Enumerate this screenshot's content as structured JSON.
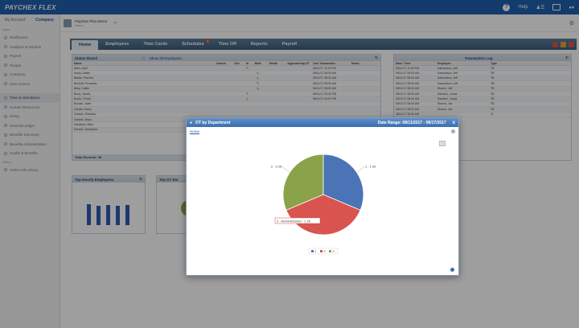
{
  "topbar": {
    "brand": "PAYCHEX FLEX",
    "help": "Help"
  },
  "leftnav": {
    "tabs": [
      "My Account",
      "Company"
    ],
    "section1": "Apps",
    "items1": [
      "Dashboard",
      "Analytics & Reports",
      "Payroll",
      "People",
      "Company",
      "User Access"
    ],
    "items2": [
      "Time & Attendance",
      "Human Resources",
      "Hiring",
      "General Ledger",
      "Benefits Summary",
      "Benefits Administration",
      "Health & Benefits"
    ],
    "section2": "Offers",
    "items3": [
      "Online HR Library"
    ]
  },
  "company": {
    "name": "Paychex Flex Demo",
    "sub": "Demo"
  },
  "tabs": [
    {
      "label": "Home",
      "badge": ""
    },
    {
      "label": "Employees",
      "badge": ""
    },
    {
      "label": "Time Cards",
      "badge": ""
    },
    {
      "label": "Schedules",
      "badge": "1"
    },
    {
      "label": "Time Off",
      "badge": ""
    },
    {
      "label": "Reports",
      "badge": ""
    },
    {
      "label": "Payroll",
      "badge": ""
    }
  ],
  "status_board": {
    "title": "Status Board",
    "show_all": "Show all employees",
    "headers": [
      "Name",
      "Absent",
      "Out",
      "In",
      "Meal",
      "Break",
      "Approaching OT",
      "Last Transaction",
      "Notes"
    ],
    "rows": [
      {
        "name": "Allen, April",
        "status": "out",
        "last": "08/11/17 11:00 PM"
      },
      {
        "name": "Avery, Austin",
        "status": "in",
        "last": "08/11/17 08:00 AM"
      },
      {
        "name": "Barker, Pamela",
        "status": "in",
        "last": "08/11/17 08:00 AM"
      },
      {
        "name": "Beckett, Fernando",
        "status": "in",
        "last": "08/11/17 08:00 AM"
      },
      {
        "name": "Berg, Caitlin",
        "status": "in",
        "last": "08/11/17 08:00 AM"
      },
      {
        "name": "Bond, James",
        "status": "out",
        "last": "08/11/17 04:00 PM"
      },
      {
        "name": "Booth, Frieda",
        "status": "out",
        "last": "08/11/17 04:00 PM"
      },
      {
        "name": "Brooke, Jalen",
        "status": "",
        "last": ""
      },
      {
        "name": "Carden, Barry",
        "status": "",
        "last": ""
      },
      {
        "name": "Chaves, Eduardo",
        "status": "",
        "last": ""
      },
      {
        "name": "Daniels, Brian",
        "status": "",
        "last": ""
      },
      {
        "name": "Davidson, Mike",
        "status": "",
        "last": ""
      },
      {
        "name": "Dorsett, Samantha",
        "status": "",
        "last": ""
      }
    ],
    "footer": "Total Records: 38"
  },
  "transaction_log": {
    "title": "Transaction Log",
    "headers": [
      "Date / Time",
      "Employee",
      "Type"
    ],
    "rows": [
      {
        "date": "08/11/17 11:00 PM",
        "emp": "Samuelson, Jeff",
        "type": "TB"
      },
      {
        "date": "08/11/17 08:00 AM",
        "emp": "Samuelson, Jeff",
        "type": "TB"
      },
      {
        "date": "08/11/17 08:00 AM",
        "emp": "Samuelson, Jeff",
        "type": "TB"
      },
      {
        "date": "08/11/17 08:00 AM",
        "emp": "Samuelson, Jeff",
        "type": "TB"
      },
      {
        "date": "08/11/17 08:00 AM",
        "emp": "Shaver, Jeff",
        "type": "TB"
      },
      {
        "date": "08/11/17 08:00 AM",
        "emp": "Ramirez, Jonas",
        "type": "TB"
      },
      {
        "date": "08/11/17 08:00 AM",
        "emp": "Ramirez, Jonas",
        "type": "TB"
      },
      {
        "date": "08/11/17 08:00 AM",
        "emp": "Shaver, Joe",
        "type": "TB"
      },
      {
        "date": "08/11/17 08:00 AM",
        "emp": "Shaver, Joe",
        "type": "TB"
      },
      {
        "date": "08/11/17 08:00 AM",
        "emp": "",
        "type": "CI"
      }
    ]
  },
  "hourly_panel": {
    "title": "Top Hourly Employees"
  },
  "ot_panel": {
    "title": "Top OT Em"
  },
  "modal": {
    "title": "OT by Department",
    "range": "Date Range: 08/11/2017 - 08/17/2017",
    "home_link": "Home",
    "close": "x"
  },
  "chart_data": {
    "type": "pie",
    "slices": [
      {
        "name": "1",
        "value": 1.05,
        "label": "1 : 1.05",
        "color": "#4a74b5"
      },
      {
        "name": "2 - Administration",
        "value": 1.25,
        "label": "2 - Administration : 1.25",
        "color": "#d9534f"
      },
      {
        "name": "3",
        "value": 1.05,
        "label": "3 : 1.05",
        "color": "#8aa34a"
      }
    ],
    "callout_labels": [
      "1 : 1.05",
      "2 - Administration : 1.25",
      "3 : 1.05"
    ],
    "legend": [
      "1",
      "2",
      "3"
    ],
    "legend_position": "bottom"
  }
}
